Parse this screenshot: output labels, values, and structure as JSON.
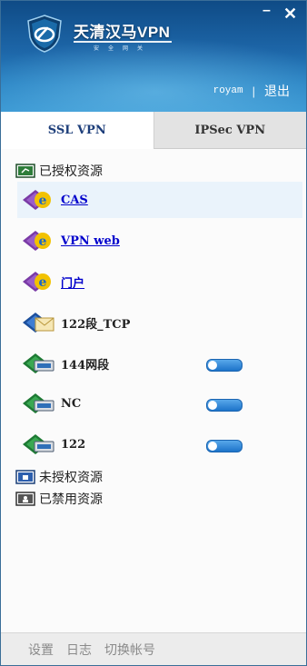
{
  "app": {
    "brand": "天清汉马VPN",
    "brand_sub": "安全网关",
    "minimize_glyph": "–",
    "close_glyph": "✕"
  },
  "user": {
    "username": "royam",
    "separator": "|",
    "logout_label": "退出"
  },
  "tabs": [
    {
      "label": "SSL VPN",
      "active": true
    },
    {
      "label": "IPSec VPN",
      "active": false
    }
  ],
  "sections": {
    "authorized": "已授权资源",
    "unauthorized": "未授权资源",
    "disabled": "已禁用资源"
  },
  "resources": [
    {
      "label": "CAS",
      "icon": "ie-web-icon",
      "link": true,
      "selected": true
    },
    {
      "label": "VPN web",
      "icon": "ie-web-icon",
      "link": true,
      "selected": false
    },
    {
      "label": "门户",
      "icon": "ie-web-icon",
      "link": true,
      "selected": false
    },
    {
      "label": "122段_TCP",
      "icon": "tcp-envelope-icon",
      "link": false,
      "selected": false
    },
    {
      "label": "144网段",
      "icon": "network-segment-icon",
      "link": false,
      "toggle": true,
      "toggle_on": true
    },
    {
      "label": "NC",
      "icon": "network-segment-icon",
      "link": false,
      "toggle": true,
      "toggle_on": true
    },
    {
      "label": "122",
      "icon": "network-segment-icon",
      "link": false,
      "toggle": true,
      "toggle_on": true
    }
  ],
  "footer": {
    "settings": "设置",
    "log": "日志",
    "switch_account": "切换帐号"
  },
  "colors": {
    "header_top": "#0f4b86",
    "header_bottom": "#3a98d3",
    "link": "#0000cc",
    "toggle": "#1d73c9"
  }
}
